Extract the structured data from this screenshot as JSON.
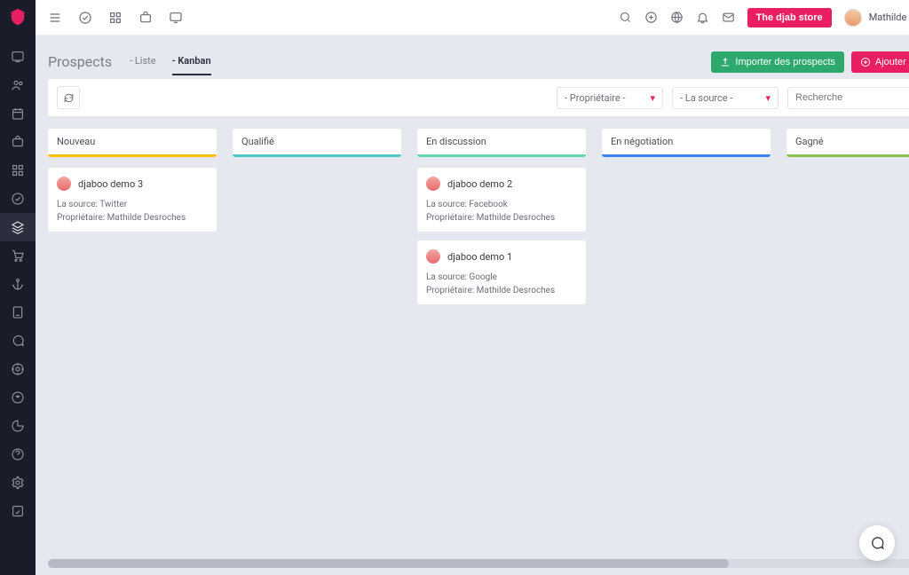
{
  "topbar": {
    "store_button": "The djab store",
    "username": "Mathilde Desroches"
  },
  "page": {
    "title": "Prospects",
    "tabs": {
      "list": "- Liste",
      "kanban": "- Kanban"
    },
    "import_button": "Importer des prospects",
    "add_button": "Ajouter prospect"
  },
  "filters": {
    "owner": "- Propriétaire -",
    "source": "- La source -",
    "search_placeholder": "Recherche"
  },
  "columns": {
    "nouveau": "Nouveau",
    "qualifie": "Qualifié",
    "discussion": "En discussion",
    "negotiation": "En négotiation",
    "gagne": "Gagné"
  },
  "cards": {
    "c1": {
      "title": "djaboo demo 3",
      "source": "La source: Twitter",
      "owner": "Propriétaire: Mathilde Desroches"
    },
    "c2": {
      "title": "djaboo demo 2",
      "source": "La source: Facebook",
      "owner": "Propriétaire: Mathilde Desroches"
    },
    "c3": {
      "title": "djaboo demo 1",
      "source": "La source: Google",
      "owner": "Propriétaire: Mathilde Desroches"
    }
  }
}
